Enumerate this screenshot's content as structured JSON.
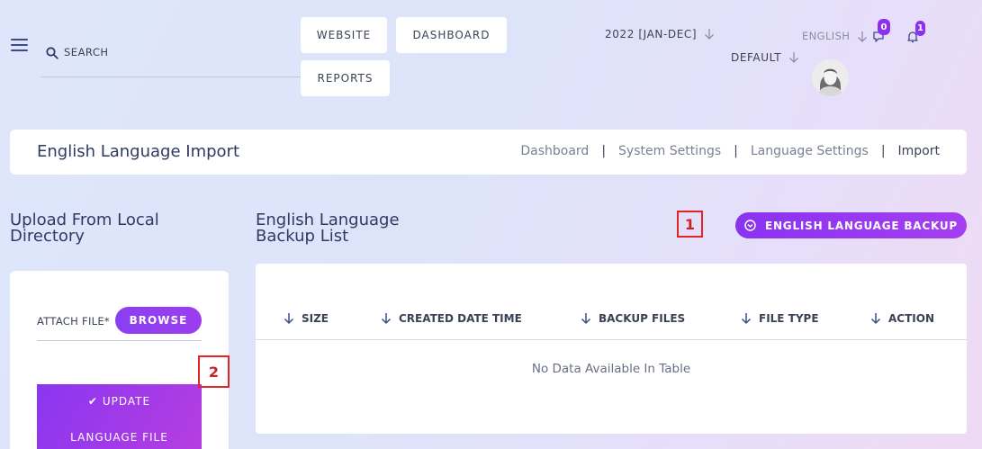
{
  "topbar": {
    "search_label": "SEARCH",
    "nav": {
      "website": "WEBSITE",
      "dashboard": "DASHBOARD",
      "reports": "REPORTS"
    },
    "year_select": "2022 [JAN-DEC]",
    "default_select": "DEFAULT",
    "language_select": "ENGLISH",
    "messages_count": "0",
    "notifications_count": "1"
  },
  "header": {
    "title": "English Language Import",
    "breadcrumbs": [
      "Dashboard",
      "System Settings",
      "Language Settings",
      "Import"
    ],
    "separator": "|"
  },
  "upload": {
    "title_line1": "Upload From Local",
    "title_line2": "Directory",
    "attach_label": "ATTACH FILE*",
    "browse_label": "BROWSE",
    "update_line1": "UPDATE",
    "update_line2": "LANGUAGE FILE"
  },
  "backup": {
    "title_line1": "English Language",
    "title_line2": "Backup List",
    "button_label": "ENGLISH LANGUAGE BACKUP",
    "columns": [
      "SIZE",
      "CREATED DATE TIME",
      "BACKUP FILES",
      "FILE TYPE",
      "ACTION"
    ],
    "empty_text": "No Data Available In Table"
  },
  "markers": {
    "m1": "1",
    "m2": "2"
  },
  "colors": {
    "accent": "#8b3ff2",
    "title": "#2f3a63",
    "marker": "#e12424"
  }
}
